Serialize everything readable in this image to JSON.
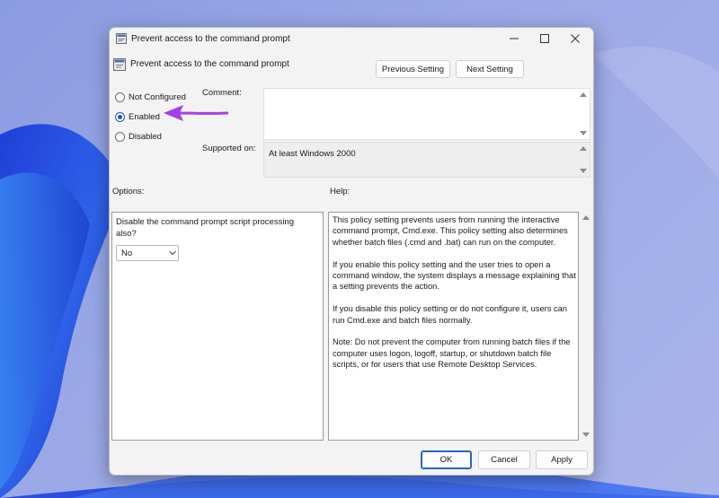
{
  "window": {
    "title": "Prevent access to the command prompt",
    "controls": {
      "minimize": "minimize",
      "maximize": "maximize",
      "close": "close"
    }
  },
  "policy": {
    "name": "Prevent access to the command prompt",
    "previous_label": "Previous Setting",
    "next_label": "Next Setting"
  },
  "state": {
    "options": [
      {
        "label": "Not Configured",
        "checked": false
      },
      {
        "label": "Enabled",
        "checked": true
      },
      {
        "label": "Disabled",
        "checked": false
      }
    ]
  },
  "comment": {
    "label": "Comment:",
    "value": ""
  },
  "supported": {
    "label": "Supported on:",
    "value": "At least Windows 2000"
  },
  "options_section": {
    "label": "Options:",
    "prompt": "Disable the command prompt script processing also?",
    "selected": "No"
  },
  "help_section": {
    "label": "Help:",
    "paragraphs": [
      "This policy setting prevents users from running the interactive command prompt, Cmd.exe.  This policy setting also determines whether batch files (.cmd and .bat) can run on the computer.",
      "If you enable this policy setting and the user tries to open a command window, the system displays a message explaining that a setting prevents the action.",
      "If you disable this policy setting or do not configure it, users can run Cmd.exe and batch files normally.",
      "Note: Do not prevent the computer from running batch files if the computer uses logon, logoff, startup, or shutdown batch file scripts, or for users that use Remote Desktop Services."
    ]
  },
  "footer": {
    "ok": "OK",
    "cancel": "Cancel",
    "apply": "Apply"
  },
  "colors": {
    "accent": "#1a56c4",
    "annotation_arrow": "#a63ee8",
    "wallpaper": "#2f5fe0"
  },
  "icons": [
    "policy-icon",
    "minimize-icon",
    "maximize-icon",
    "close-icon",
    "chevron-down-icon",
    "scroll-up-icon",
    "scroll-down-icon",
    "annotation-arrow-icon"
  ]
}
